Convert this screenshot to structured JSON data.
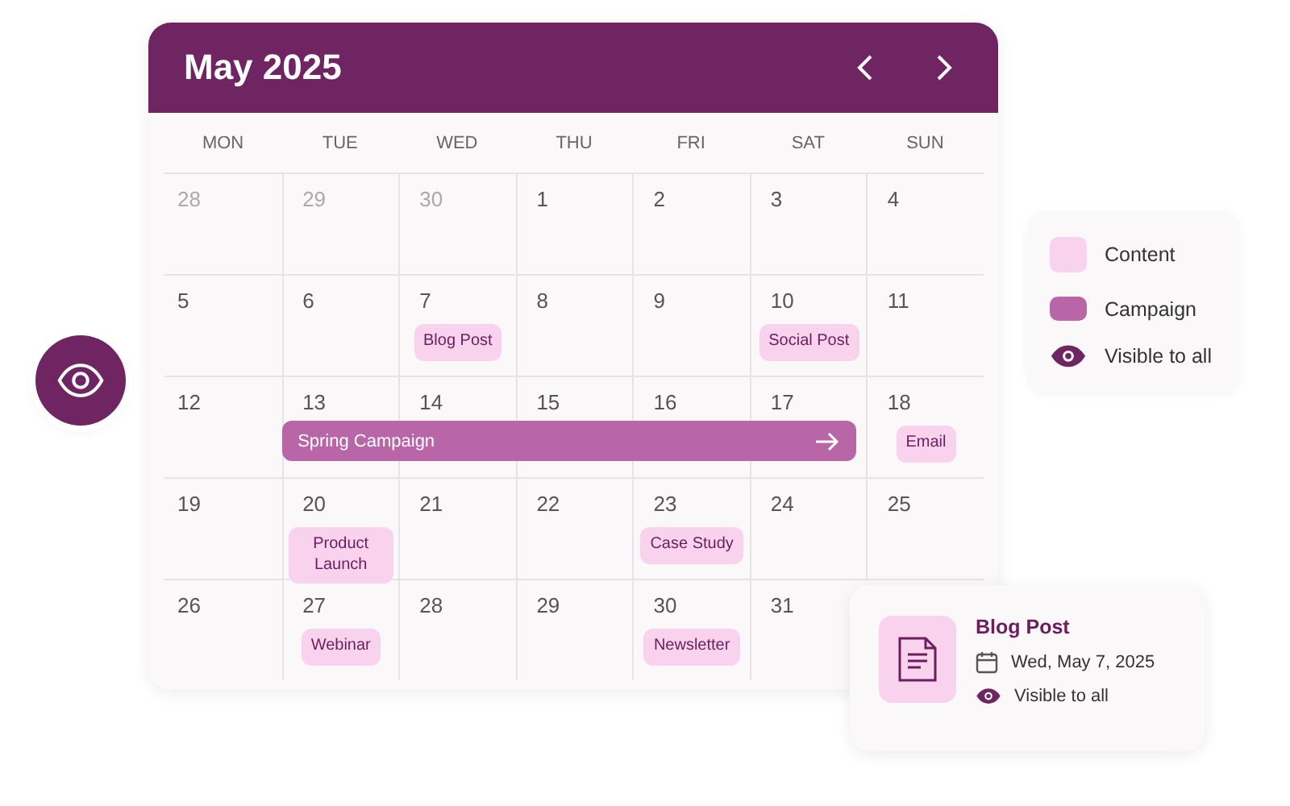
{
  "calendar": {
    "title": "May 2025",
    "weekdays": [
      "MON",
      "TUE",
      "WED",
      "THU",
      "FRI",
      "SAT",
      "SUN"
    ],
    "weeks": [
      {
        "days": [
          {
            "date": "28",
            "muted": true
          },
          {
            "date": "29",
            "muted": true
          },
          {
            "date": "30",
            "muted": true
          },
          {
            "date": "1",
            "muted": false
          },
          {
            "date": "2",
            "muted": false
          },
          {
            "date": "3",
            "muted": false
          },
          {
            "date": "4",
            "muted": false
          }
        ]
      },
      {
        "days": [
          {
            "date": "5",
            "muted": false
          },
          {
            "date": "6",
            "muted": false
          },
          {
            "date": "7",
            "muted": false,
            "event": "Blog Post"
          },
          {
            "date": "8",
            "muted": false
          },
          {
            "date": "9",
            "muted": false
          },
          {
            "date": "10",
            "muted": false,
            "event": "Social Post"
          },
          {
            "date": "11",
            "muted": false
          }
        ]
      },
      {
        "campaign": "Spring Campaign",
        "days": [
          {
            "date": "12",
            "muted": false
          },
          {
            "date": "13",
            "muted": false,
            "in_campaign": true
          },
          {
            "date": "14",
            "muted": false,
            "in_campaign": true
          },
          {
            "date": "15",
            "muted": false,
            "in_campaign": true
          },
          {
            "date": "16",
            "muted": false,
            "in_campaign": true
          },
          {
            "date": "17",
            "muted": false,
            "in_campaign": true
          },
          {
            "date": "18",
            "muted": false,
            "event": "Email"
          }
        ]
      },
      {
        "days": [
          {
            "date": "19",
            "muted": false
          },
          {
            "date": "20",
            "muted": false,
            "event": "Product Launch"
          },
          {
            "date": "21",
            "muted": false
          },
          {
            "date": "22",
            "muted": false
          },
          {
            "date": "23",
            "muted": false,
            "event": "Case Study"
          },
          {
            "date": "24",
            "muted": false
          },
          {
            "date": "25",
            "muted": false
          }
        ]
      },
      {
        "days": [
          {
            "date": "26",
            "muted": false
          },
          {
            "date": "27",
            "muted": false,
            "event": "Webinar"
          },
          {
            "date": "28",
            "muted": false
          },
          {
            "date": "29",
            "muted": false
          },
          {
            "date": "30",
            "muted": false,
            "event": "Newsletter"
          },
          {
            "date": "31",
            "muted": false
          }
        ]
      }
    ]
  },
  "legend": [
    {
      "kind": "content",
      "label": "Content"
    },
    {
      "kind": "campaign",
      "label": "Campaign"
    },
    {
      "kind": "visibility",
      "label": "Visible to all"
    }
  ],
  "detail": {
    "title": "Blog Post",
    "date": "Wed, May 7, 2025",
    "visibility": "Visible to all"
  }
}
